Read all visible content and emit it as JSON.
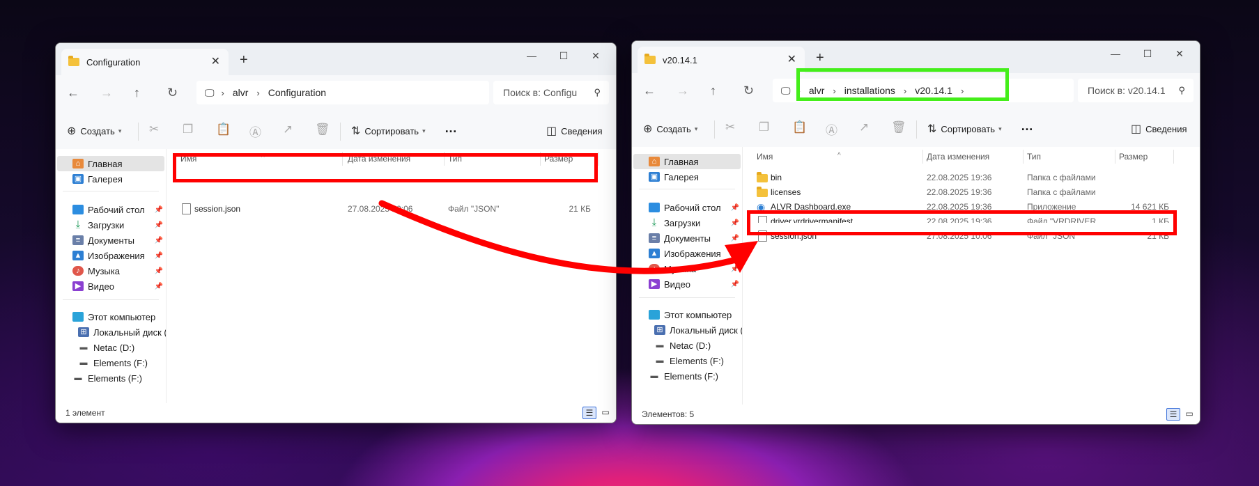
{
  "colors": {
    "highlight_red": "#ff0000",
    "highlight_green": "#44ee1a",
    "folder": "#f4c13b"
  },
  "left": {
    "tab_title": "Configuration",
    "new_tab": "+",
    "breadcrumb": [
      "alvr",
      "Configuration"
    ],
    "search_placeholder": "Поиск в: Configu",
    "toolbar": {
      "create": "Создать",
      "sort": "Сортировать",
      "more": "…",
      "details": "Сведения"
    },
    "columns": {
      "name": "Имя",
      "date": "Дата изменения",
      "type": "Тип",
      "size": "Размер"
    },
    "files": [
      {
        "name": "session.json",
        "date": "27.08.2025 10:06",
        "type": "Файл \"JSON\"",
        "size": "21 КБ",
        "icon": "file-icon"
      }
    ],
    "status": "1 элемент"
  },
  "right": {
    "tab_title": "v20.14.1",
    "new_tab": "+",
    "breadcrumb": [
      "alvr",
      "installations",
      "v20.14.1"
    ],
    "search_placeholder": "Поиск в: v20.14.1",
    "toolbar": {
      "create": "Создать",
      "sort": "Сортировать",
      "more": "…",
      "details": "Сведения"
    },
    "columns": {
      "name": "Имя",
      "date": "Дата изменения",
      "type": "Тип",
      "size": "Размер"
    },
    "files": [
      {
        "name": "bin",
        "date": "22.08.2025 19:36",
        "type": "Папка с файлами",
        "size": "",
        "icon": "folder-icon"
      },
      {
        "name": "licenses",
        "date": "22.08.2025 19:36",
        "type": "Папка с файлами",
        "size": "",
        "icon": "folder-icon"
      },
      {
        "name": "ALVR Dashboard.exe",
        "date": "22.08.2025 19:36",
        "type": "Приложение",
        "size": "14 621 КБ",
        "icon": "app-icon"
      },
      {
        "name": "driver.vrdrivermanifest",
        "date": "22.08.2025 19:36",
        "type": "Файл \"VRDRIVER",
        "size": "1 КБ",
        "icon": "file-icon"
      },
      {
        "name": "session.json",
        "date": "27.08.2025 10:06",
        "type": "Файл \"JSON\"",
        "size": "21 КБ",
        "icon": "file-icon"
      }
    ],
    "status": "Элементов: 5"
  },
  "sidebar": {
    "home": "Главная",
    "gallery": "Галерея",
    "desktop": "Рабочий стол",
    "downloads": "Загрузки",
    "documents": "Документы",
    "pictures": "Изображения",
    "music": "Музыка",
    "video": "Видео",
    "this_pc": "Этот компьютер",
    "local_disk": "Локальный диск (С",
    "netac": "Netac (D:)",
    "elements_f_1": "Elements (F:)",
    "elements_f_2": "Elements (F:)"
  }
}
